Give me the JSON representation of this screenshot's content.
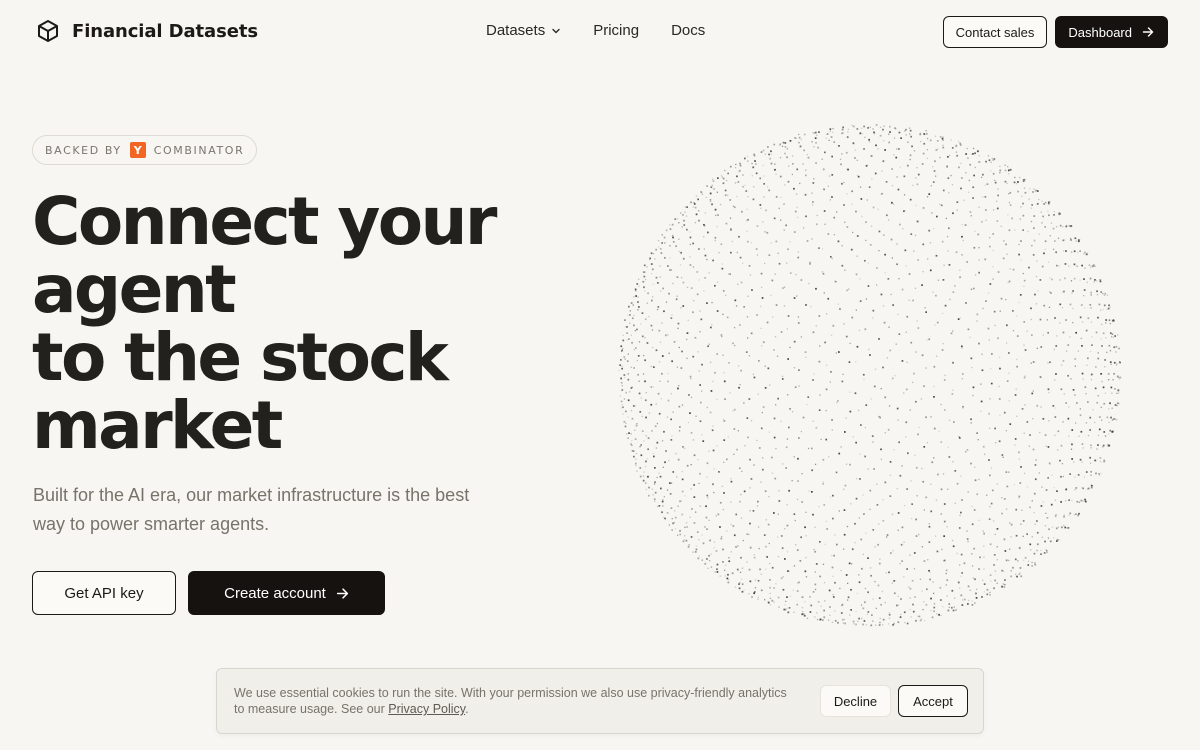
{
  "header": {
    "brand_name": "Financial Datasets",
    "brand_icon": "cube-icon",
    "nav": {
      "datasets": "Datasets",
      "pricing": "Pricing",
      "docs": "Docs"
    },
    "contact_label": "Contact sales",
    "dashboard_label": "Dashboard"
  },
  "hero": {
    "badge_prefix": "BACKED BY",
    "badge_logo": "Y",
    "badge_suffix": "COMBINATOR",
    "headline_lines": [
      "Connect your",
      "agent",
      "to the stock",
      "market"
    ],
    "subtext": "Built for the AI era, our market infrastructure is the best way to power smarter agents.",
    "primary_cta": "Create account",
    "secondary_cta": "Get API key"
  },
  "cookie": {
    "text": "We use essential cookies to run the site. With your permission we also use privacy-friendly analytics to measure usage. See our ",
    "link": "Privacy Policy",
    "after": ".",
    "decline": "Decline",
    "accept": "Accept"
  },
  "colors": {
    "background": "#f7f6f2",
    "primary_button": "#15120f",
    "yc_orange": "#f26522",
    "text_muted": "#77736b"
  }
}
